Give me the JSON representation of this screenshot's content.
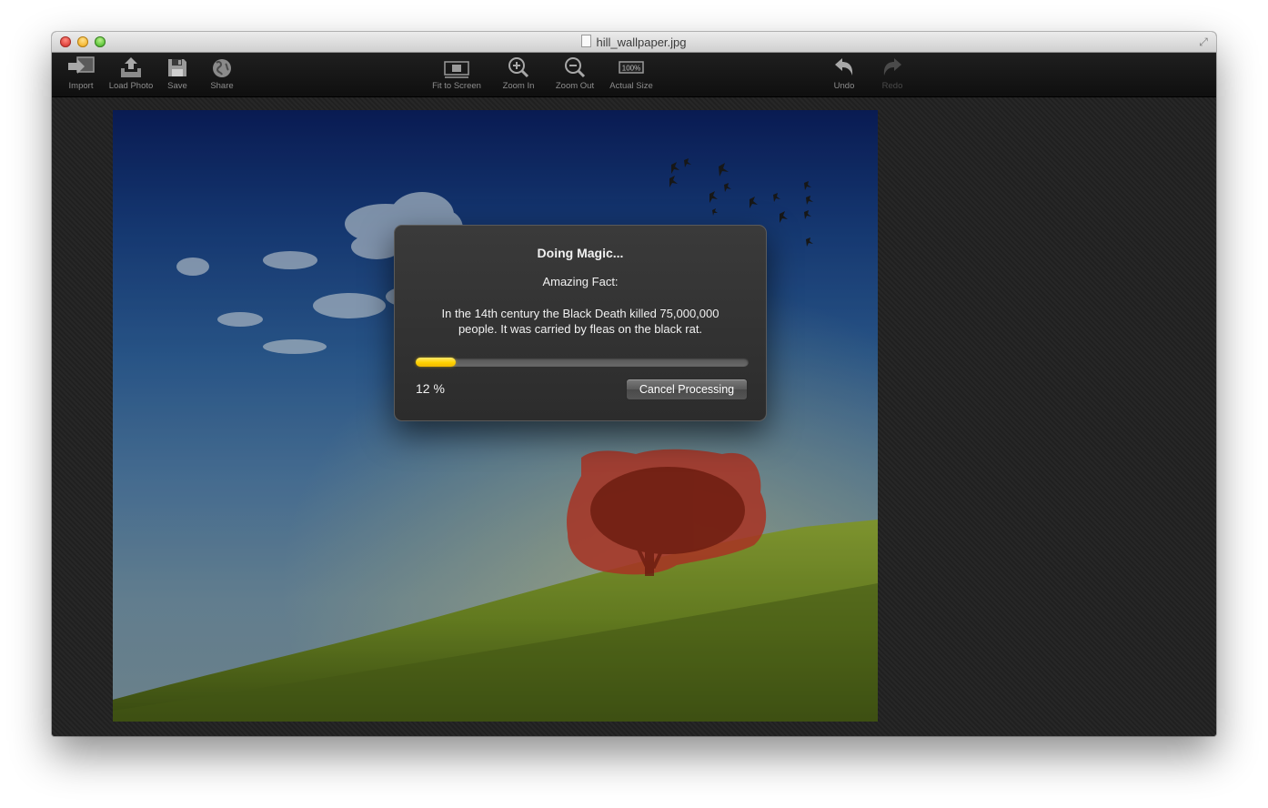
{
  "window": {
    "title": "hill_wallpaper.jpg"
  },
  "toolbar": {
    "left_items": [
      {
        "label": "Import",
        "icon": "import-icon"
      },
      {
        "label": "Load Photo",
        "icon": "load-photo-icon"
      },
      {
        "label": "Save",
        "icon": "save-icon"
      },
      {
        "label": "Share",
        "icon": "share-icon"
      }
    ],
    "center_items": [
      {
        "label": "Fit to Screen",
        "icon": "fit-to-screen-icon"
      },
      {
        "label": "Zoom In",
        "icon": "zoom-in-icon"
      },
      {
        "label": "Zoom Out",
        "icon": "zoom-out-icon"
      },
      {
        "label": "Actual Size",
        "icon": "actual-size-icon",
        "badge": "100%"
      }
    ],
    "right_items": [
      {
        "label": "Undo",
        "icon": "undo-icon",
        "enabled": true
      },
      {
        "label": "Redo",
        "icon": "redo-icon",
        "enabled": false
      }
    ]
  },
  "dialog": {
    "title": "Doing Magic...",
    "subtitle": "Amazing Fact:",
    "fact_line1": "In the 14th century the Black Death killed 75,000,000",
    "fact_line2": "people. It was carried by fleas on the black rat.",
    "progress_fraction": 0.12,
    "progress_text": "12 %",
    "cancel_label": "Cancel Processing"
  },
  "colors": {
    "progress": "#ffd200",
    "selection_overlay": "#c0392b",
    "toolbar_bg": "#141414"
  }
}
